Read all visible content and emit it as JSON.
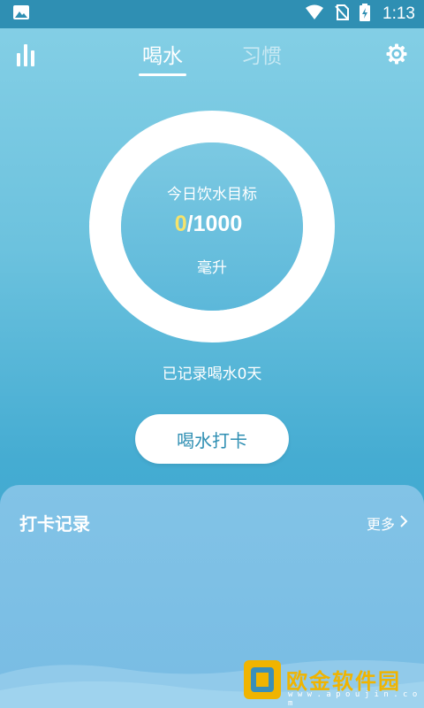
{
  "status_bar": {
    "time": "1:13",
    "icons": [
      "image-icon",
      "wifi-icon",
      "no-sim-icon",
      "battery-icon"
    ]
  },
  "tabs": [
    {
      "label": "喝水",
      "active": true
    },
    {
      "label": "习惯",
      "active": false
    }
  ],
  "goal": {
    "title": "今日饮水目标",
    "current": "0",
    "separator": "/",
    "target": "1000",
    "unit": "毫升",
    "progress": 0
  },
  "record_days": "已记录喝水0天",
  "checkin_button": "喝水打卡",
  "records": {
    "title": "打卡记录",
    "more": "更多"
  },
  "watermark": {
    "text": "欧金软件园",
    "sub": "w w w . a p o u j i n . c o m"
  },
  "colors": {
    "accent_yellow": "#f5e36b",
    "status_bar": "#2f8fb3",
    "button_text": "#2f8fb3",
    "watermark": "#f0b400"
  }
}
